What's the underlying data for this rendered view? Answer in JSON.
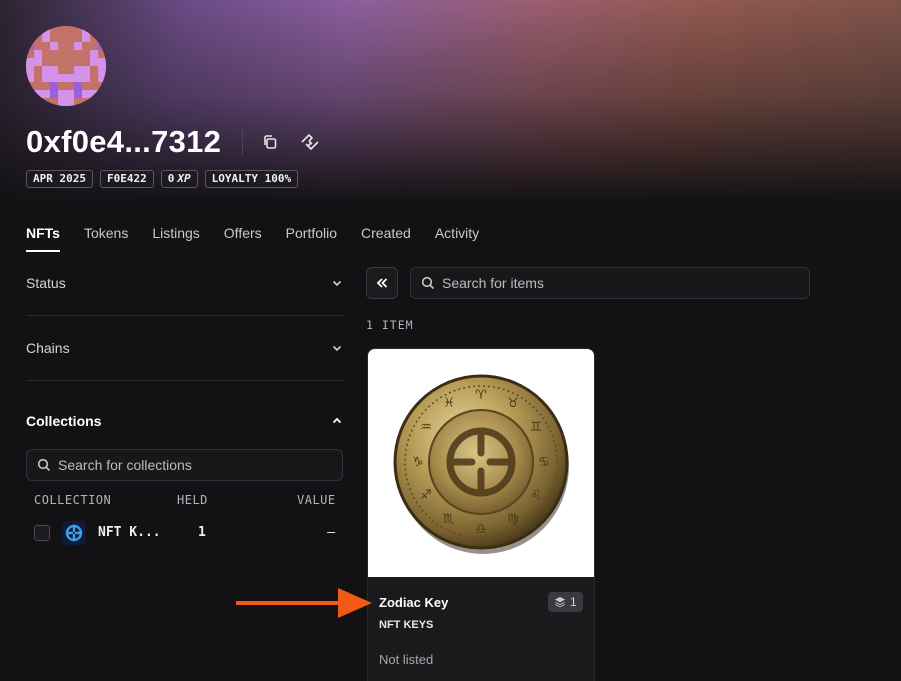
{
  "profile": {
    "address": "0xf0e4...7312",
    "badges": [
      "APR 2025",
      "F0E422"
    ],
    "xp_value": "0",
    "xp_unit": "XP",
    "loyalty_badge": "LOYALTY 100%"
  },
  "tabs": [
    "NFTs",
    "Tokens",
    "Listings",
    "Offers",
    "Portfolio",
    "Created",
    "Activity"
  ],
  "filters": {
    "status_label": "Status",
    "chains_label": "Chains",
    "collections_label": "Collections",
    "collection_search_placeholder": "Search for collections",
    "columns": [
      "COLLECTION",
      "HELD",
      "VALUE"
    ],
    "rows": [
      {
        "name": "NFT K...",
        "held": "1",
        "value": "–"
      }
    ]
  },
  "results": {
    "search_placeholder": "Search for items",
    "item_count": "1 ITEM",
    "items": [
      {
        "name": "Zodiac Key",
        "collection": "NFT KEYS",
        "quantity": "1",
        "status": "Not listed"
      }
    ]
  },
  "colors": {
    "accent_arrow": "#f05a14",
    "background": "#121113"
  },
  "icons": {
    "copy": "copy-icon",
    "share": "handshake-icon",
    "chevron_down": "chevron-down-icon",
    "chevron_up": "chevron-up-icon",
    "search": "search-icon",
    "collapse": "double-chevron-left-icon",
    "stack": "layers-icon"
  }
}
